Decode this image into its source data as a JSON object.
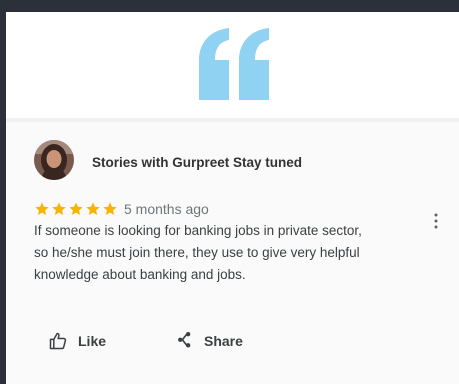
{
  "colors": {
    "page_background": "#2b3039",
    "quote_mark": "#8fd2f2",
    "star": "#f4b400",
    "text": "#3c4043"
  },
  "quote": {
    "icon": "quote-icon"
  },
  "review": {
    "author": "Stories with Gurpreet Stay tuned",
    "rating": 5,
    "rating_max": 5,
    "time": "5 months ago",
    "text_lines": [
      "If someone is looking for banking jobs in private sector,",
      "so he/she must join there, they use to give very helpful",
      "knowledge about banking and jobs."
    ]
  },
  "actions": {
    "like_label": "Like",
    "share_label": "Share",
    "like_icon": "thumbs-up-icon",
    "share_icon": "share-icon"
  }
}
